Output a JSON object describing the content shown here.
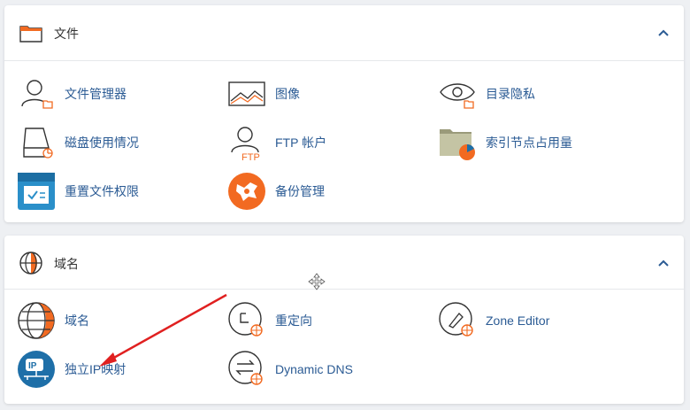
{
  "files": {
    "title": "文件",
    "items": [
      {
        "label": "文件管理器",
        "icon": "file-manager-icon"
      },
      {
        "label": "图像",
        "icon": "images-icon"
      },
      {
        "label": "目录隐私",
        "icon": "directory-privacy-icon"
      },
      {
        "label": "磁盘使用情况",
        "icon": "disk-usage-icon"
      },
      {
        "label": "FTP 帐户",
        "icon": "ftp-accounts-icon"
      },
      {
        "label": "索引节点占用量",
        "icon": "inode-usage-icon"
      },
      {
        "label": "重置文件权限",
        "icon": "reset-permissions-icon"
      },
      {
        "label": "备份管理",
        "icon": "backup-manager-icon"
      }
    ]
  },
  "domains": {
    "title": "域名",
    "items": [
      {
        "label": "域名",
        "icon": "domains-icon"
      },
      {
        "label": "重定向",
        "icon": "redirects-icon"
      },
      {
        "label": "Zone Editor",
        "icon": "zone-editor-icon"
      },
      {
        "label": "独立IP映射",
        "icon": "dedicated-ip-icon"
      },
      {
        "label": "Dynamic DNS",
        "icon": "dynamic-dns-icon"
      }
    ]
  },
  "colors": {
    "accent": "#f26a21",
    "link": "#2b5b94",
    "annotation_arrow": "#e02020",
    "ip_badge": "#1e6fa8"
  },
  "ftp_text": "FTP",
  "ip_text": "IP"
}
